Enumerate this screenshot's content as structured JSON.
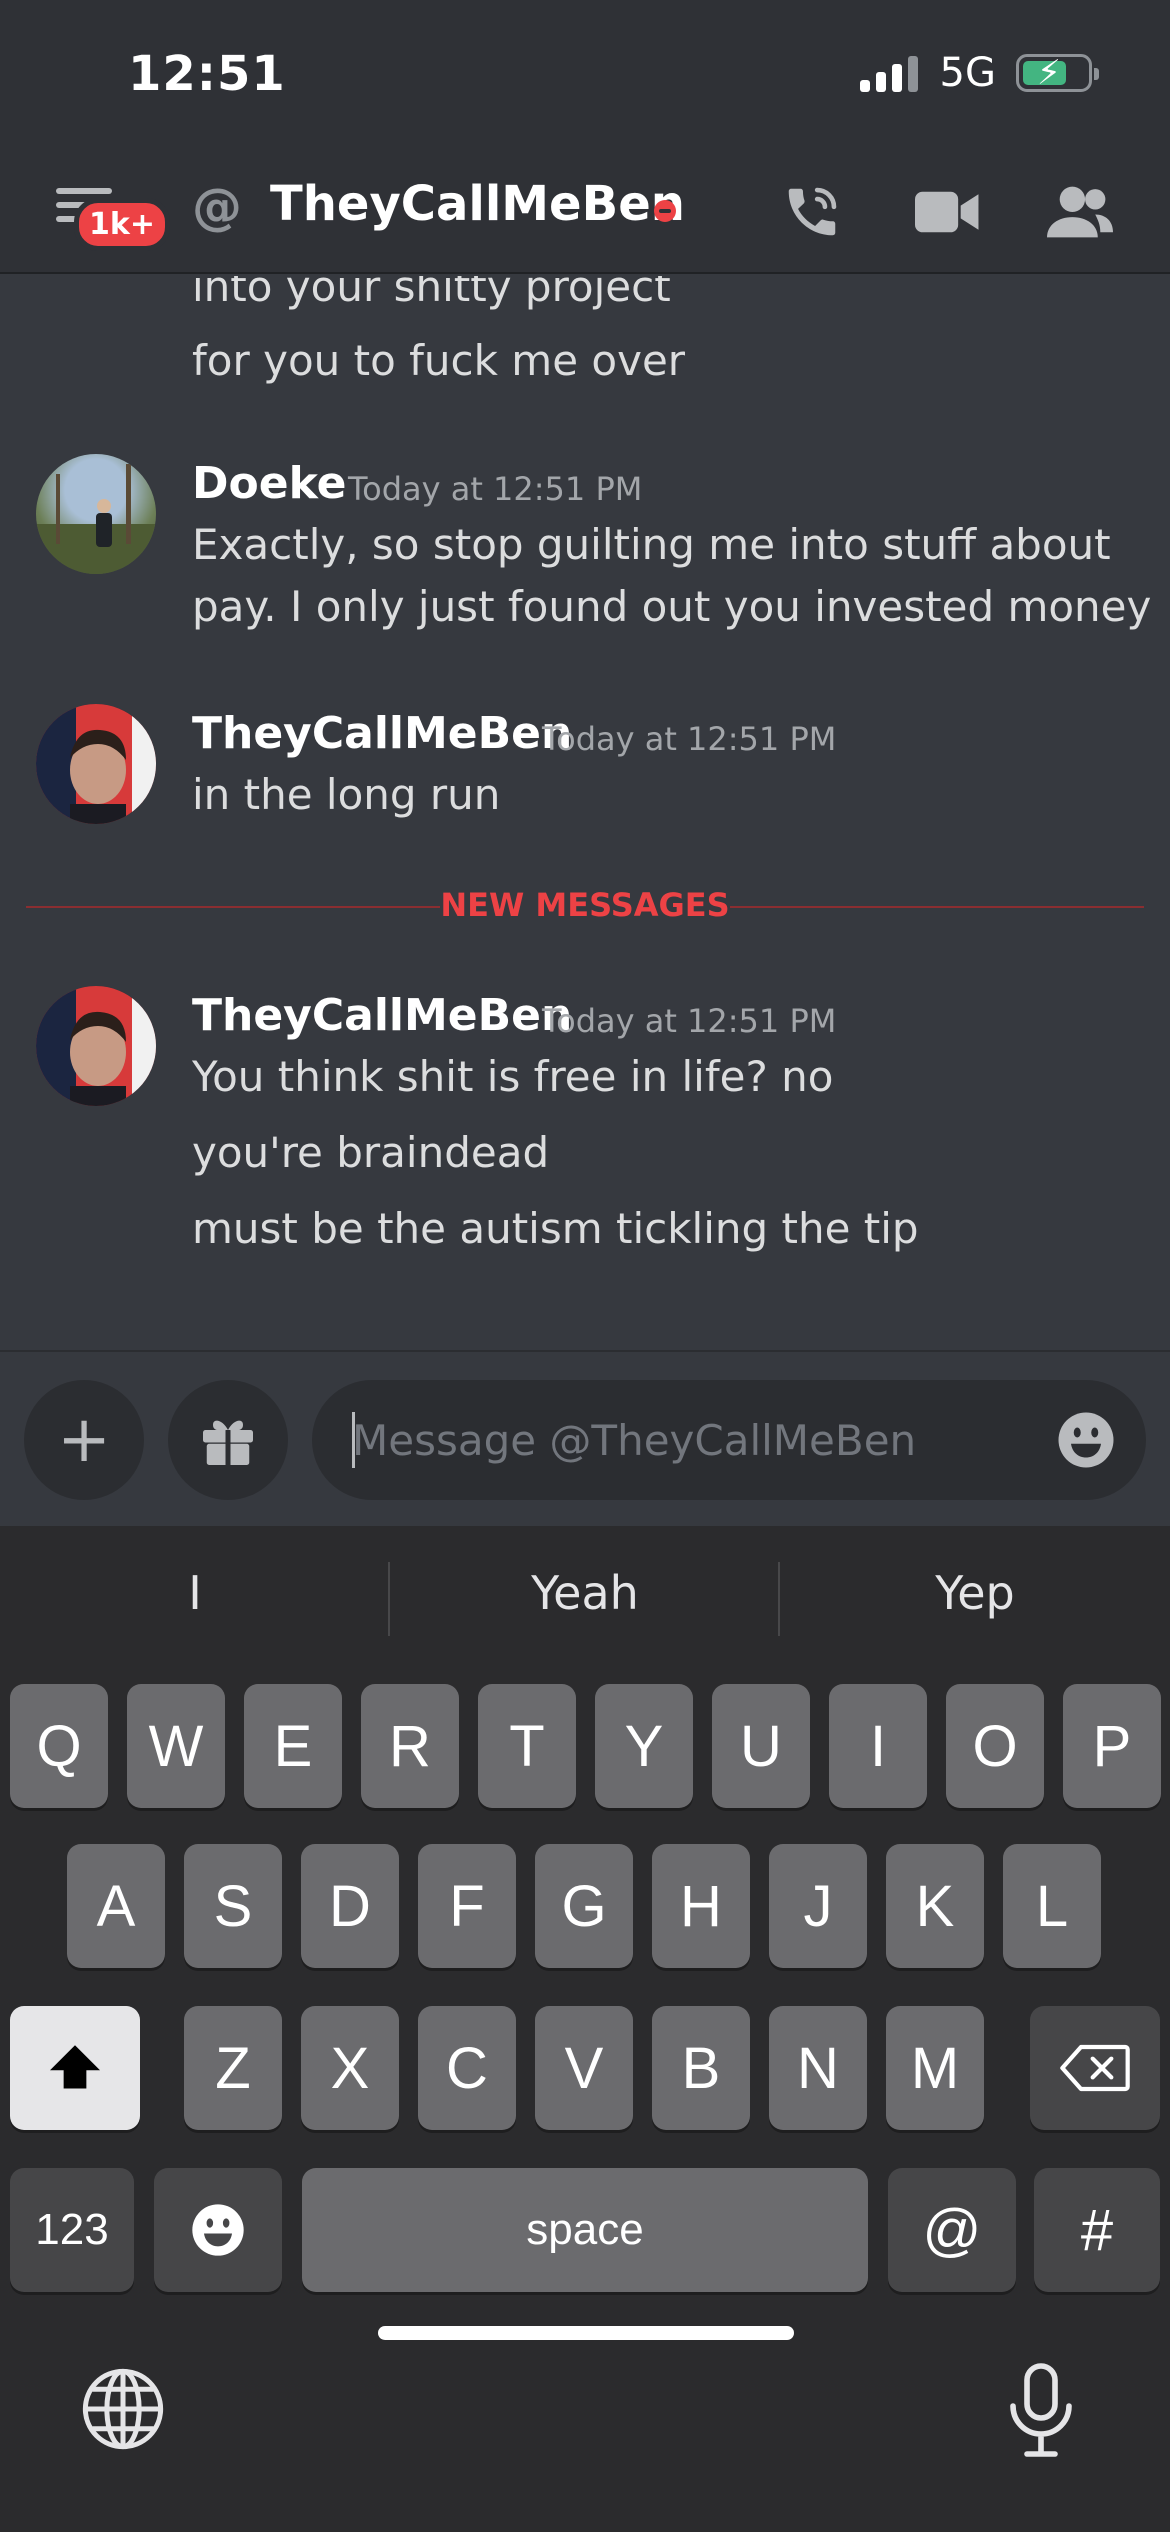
{
  "status_bar": {
    "time": "12:51",
    "network": "5G"
  },
  "header": {
    "badge": "1k+",
    "at_symbol": "@",
    "title": "TheyCallMeBen"
  },
  "messages": {
    "prev_lines": [
      "into your shitty project",
      "for you to fuck me over"
    ],
    "groups": [
      {
        "author": "Doeke",
        "time": "Today at 12:51 PM",
        "lines": [
          "Exactly, so stop guilting me into stuff about",
          "pay. I only just found out you invested money"
        ]
      },
      {
        "author": "TheyCallMeBen",
        "time": "Today at 12:51 PM",
        "lines": [
          "in the long run"
        ]
      },
      {
        "author": "TheyCallMeBen",
        "time": "Today at 12:51 PM",
        "lines": [
          "You think shit is free in life? no",
          "you're braindead",
          "must be the autism tickling the tip"
        ]
      }
    ],
    "new_messages_label": "NEW MESSAGES"
  },
  "composer": {
    "placeholder": "Message @TheyCallMeBen",
    "plus": "+"
  },
  "keyboard": {
    "suggestions": [
      "I",
      "Yeah",
      "Yep"
    ],
    "row1": [
      "Q",
      "W",
      "E",
      "R",
      "T",
      "Y",
      "U",
      "I",
      "O",
      "P"
    ],
    "row2": [
      "A",
      "S",
      "D",
      "F",
      "G",
      "H",
      "J",
      "K",
      "L"
    ],
    "row3": [
      "Z",
      "X",
      "C",
      "V",
      "B",
      "N",
      "M"
    ],
    "numbers_label": "123",
    "space_label": "space",
    "at_label": "@",
    "hash_label": "#"
  },
  "colors": {
    "background": "#36393f",
    "header": "#2f3136",
    "danger": "#ed4245",
    "keyboard": "#2b2b2d"
  }
}
